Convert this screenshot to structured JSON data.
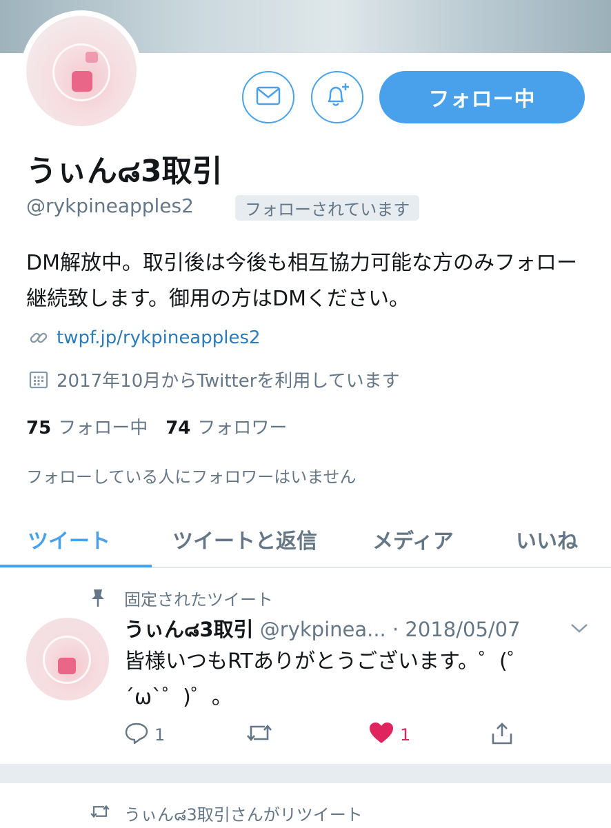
{
  "profile": {
    "name": "うぃん๘3取引",
    "handle": "@rykpineapples2",
    "follows_you_badge": "フォローされています",
    "follow_button_label": "フォロー中",
    "bio": "DM解放中。取引後は今後も相互協力可能な方のみフォロー継続致します。御用の方はDMください。",
    "link": "twpf.jp/rykpineapples2",
    "joined": "2017年10月からTwitterを利用しています",
    "following_count": "75",
    "following_label": "フォロー中",
    "followers_count": "74",
    "followers_label": "フォロワー",
    "no_mutual_followers": "フォローしている人にフォロワーはいません"
  },
  "tabs": [
    {
      "label": "ツイート",
      "active": true
    },
    {
      "label": "ツイートと返信",
      "active": false
    },
    {
      "label": "メディア",
      "active": false
    },
    {
      "label": "いいね",
      "active": false
    }
  ],
  "pinned_tweet": {
    "pinned_label": "固定されたツイート",
    "author_name": "うぃん๘3取引",
    "author_handle": "@rykpinea...",
    "date": "· 2018/05/07",
    "text": "皆様いつもRTありがとうございます。゜(゜´ω`゜)゜。",
    "reply_count": "1",
    "like_count": "1"
  },
  "next_item": {
    "retweet_label": "うぃん๘3取引さんがリツイート"
  },
  "colors": {
    "accent": "#4aa1eb",
    "secondary_text": "#657786",
    "link": "#2b7bb9",
    "like": "#e0245e"
  },
  "icons": [
    "mail-icon",
    "bell-plus-icon",
    "link-icon",
    "calendar-icon",
    "pin-icon",
    "chevron-down-icon",
    "reply-icon",
    "retweet-icon",
    "heart-icon",
    "share-icon"
  ]
}
